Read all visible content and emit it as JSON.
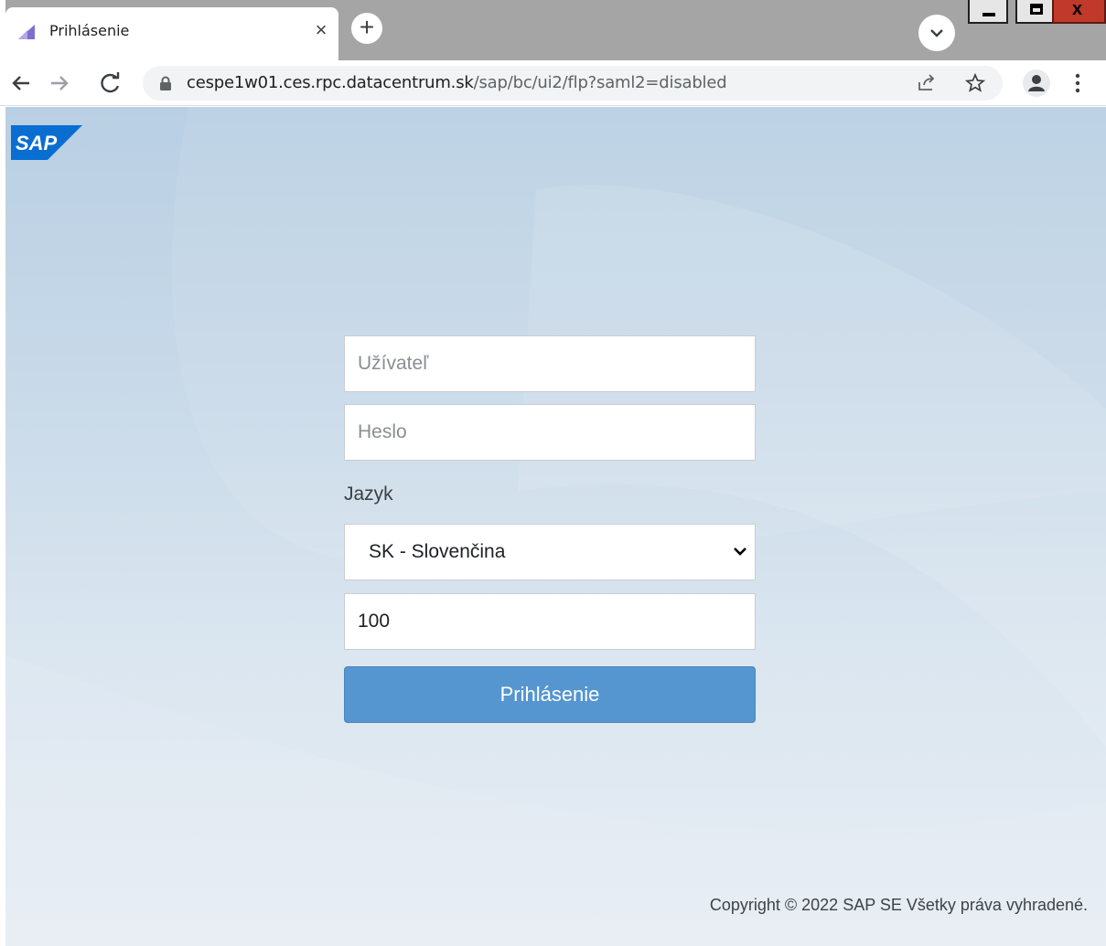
{
  "browser": {
    "tab_title": "Prihlásenie",
    "url_host": "cespe1w01.ces.rpc.datacentrum.sk",
    "url_path": "/sap/bc/ui2/flp?saml2=disabled"
  },
  "brand": {
    "logo_text": "SAP",
    "logo_color": "#0a6ed1"
  },
  "login": {
    "user_placeholder": "Užívateľ",
    "password_placeholder": "Heslo",
    "language_label": "Jazyk",
    "language_selected": "SK - Slovenčina",
    "client_value": "100",
    "submit_label": "Prihlásenie",
    "button_color": "#5596d0"
  },
  "footer": {
    "copyright": "Copyright © 2022 SAP SE Všetky práva vyhradené."
  }
}
